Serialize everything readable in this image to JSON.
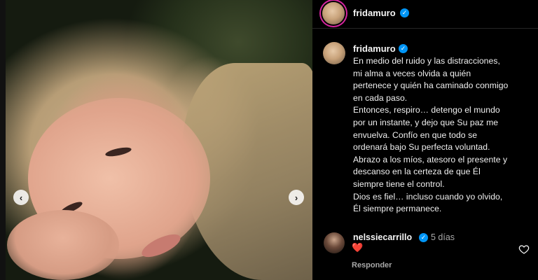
{
  "post": {
    "username": "fridamuro",
    "verified_mark": "✓"
  },
  "carousel": {
    "prev_glyph": "‹",
    "next_glyph": "›"
  },
  "caption": {
    "username": "fridamuro",
    "text": "En medio del ruido y las distracciones,\nmi alma a veces olvida a quién\npertenece y quién ha caminado conmigo\nen cada paso.\nEntonces, respiro… detengo el mundo\npor un instante, y dejo que Su paz me\nenvuelva. Confío en que todo se\nordenará bajo Su perfecta voluntad.\nAbrazo a los míos, atesoro el presente y\ndescanso en la certeza de que Él\nsiempre tiene el control.\nDios es fiel… incluso cuando yo olvido,\nÉl siempre permanece."
  },
  "comment": {
    "username": "nelssiecarrillo",
    "time": "5 días",
    "text": "❤️",
    "reply_label": "Responder"
  },
  "colors": {
    "verified": "#0095f6",
    "heart": "#ff2d3b",
    "background": "#000000"
  }
}
